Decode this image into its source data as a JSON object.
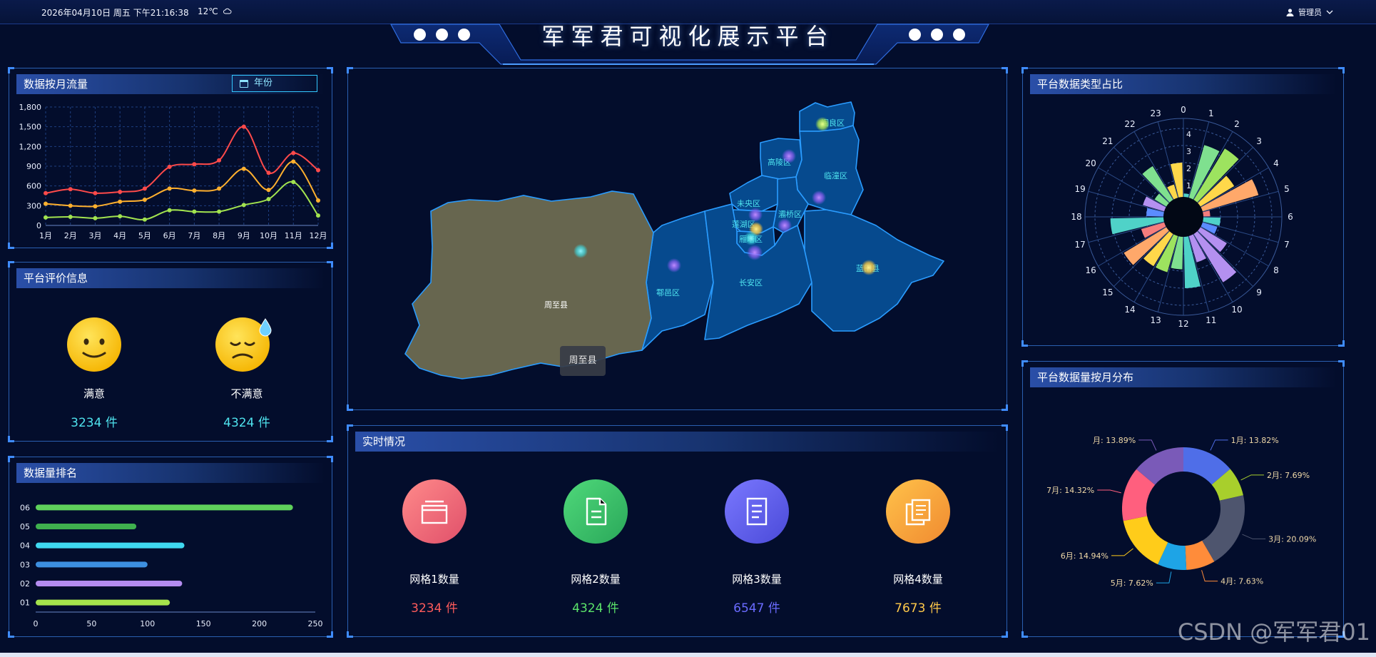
{
  "header": {
    "datetime": "2026年04月10日 周五 下午21:16:38",
    "weather": "12℃",
    "title": "军军君可视化展示平台",
    "user": "管理员"
  },
  "colors": {
    "bg": "#030d2c",
    "panel_border": "#2a5fb0",
    "accent_cyan": "#4fe3ee"
  },
  "panels": {
    "monthly_flow": {
      "title": "数据按月流量",
      "year_button": "年份"
    },
    "evaluation": {
      "title": "平台评价信息",
      "satisfied_label": "满意",
      "satisfied_value": "3234 件",
      "unsatisfied_label": "不满意",
      "unsatisfied_value": "4324 件"
    },
    "ranking": {
      "title": "数据量排名"
    },
    "map": {
      "tooltip": "周至县",
      "regions": [
        "阎良区",
        "高陵区",
        "临潼区",
        "未央区",
        "灞桥区",
        "莲湖区",
        "雁塔区",
        "鄠邑区",
        "长安区",
        "蓝田县",
        "周至县"
      ]
    },
    "realtime": {
      "title": "实时情况",
      "items": [
        {
          "label": "网格1数量",
          "value": "3234 件",
          "color": "#ff5b5b",
          "icon": "box-icon"
        },
        {
          "label": "网格2数量",
          "value": "4324 件",
          "color": "#5be36a",
          "icon": "document-icon"
        },
        {
          "label": "网格3数量",
          "value": "6547 件",
          "color": "#6a6bff",
          "icon": "list-document-icon"
        },
        {
          "label": "网格4数量",
          "value": "7673 件",
          "color": "#ffc94a",
          "icon": "copy-icon"
        }
      ]
    },
    "type_ratio": {
      "title": "平台数据类型占比"
    },
    "monthly_dist": {
      "title": "平台数据量按月分布"
    }
  },
  "watermark": "CSDN @军军君01",
  "chart_data": [
    {
      "id": "monthly-flow",
      "type": "line",
      "categories": [
        "1月",
        "2月",
        "3月",
        "4月",
        "5月",
        "6月",
        "7月",
        "8月",
        "9月",
        "10月",
        "11月",
        "12月"
      ],
      "ylim": [
        0,
        1800
      ],
      "yticks": [
        "0",
        "300",
        "600",
        "900",
        "1,200",
        "1,500",
        "1,800"
      ],
      "grid": true,
      "series": [
        {
          "color": "#ff4a4a",
          "values": [
            490,
            550,
            490,
            510,
            560,
            890,
            930,
            990,
            1500,
            800,
            1100,
            840
          ]
        },
        {
          "color": "#ffb02e",
          "values": [
            330,
            300,
            290,
            360,
            390,
            560,
            530,
            560,
            860,
            540,
            970,
            380
          ]
        },
        {
          "color": "#a2e34f",
          "values": [
            120,
            130,
            110,
            140,
            90,
            230,
            210,
            210,
            310,
            400,
            660,
            150
          ]
        }
      ]
    },
    {
      "id": "ranking",
      "type": "bar",
      "orientation": "horizontal",
      "categories": [
        "06",
        "05",
        "04",
        "03",
        "02",
        "01"
      ],
      "xlim": [
        0,
        250
      ],
      "xticks": [
        "0",
        "50",
        "100",
        "150",
        "200",
        "250"
      ],
      "values": [
        230,
        90,
        133,
        100,
        131,
        120
      ],
      "colors": [
        "#5fd05b",
        "#3fb04e",
        "#3fd8f0",
        "#3d8fe0",
        "#b48cf0",
        "#a5e34c"
      ]
    },
    {
      "id": "type-ratio",
      "type": "bar",
      "polar": true,
      "categories": [
        "0",
        "1",
        "2",
        "3",
        "4",
        "5",
        "6",
        "7",
        "8",
        "9",
        "10",
        "11",
        "12",
        "13",
        "14",
        "15",
        "16",
        "17",
        "18",
        "19",
        "20",
        "21",
        "22",
        "23"
      ],
      "rticks": [
        "1",
        "2",
        "3",
        "4"
      ],
      "rlim": [
        0,
        4
      ],
      "values": [
        0.2,
        3.2,
        3.5,
        2.3,
        3.4,
        0.4,
        1.0,
        0.9,
        1.8,
        3.3,
        1.6,
        3.0,
        1.9,
        2.2,
        2.2,
        2.9,
        1.4,
        3.1,
        1.0,
        1.3,
        0.8,
        2.3,
        0.8,
        2.0
      ],
      "colors": [
        "#4fd2c8",
        "#7fe08f",
        "#9de35f",
        "#ffd84a",
        "#ffa86a",
        "#f57d7d",
        "#4fd2c8",
        "#5b8cff",
        "#b490f0",
        "#b490f0",
        "#b490f0",
        "#4fd2c8",
        "#7fe08f",
        "#9de35f",
        "#ffd84a",
        "#ffa86a",
        "#f57d7d",
        "#4fd2c8",
        "#5b8cff",
        "#b490f0",
        "#7fe08f",
        "#7fe08f",
        "#ffd84a",
        "#ffd84a"
      ]
    },
    {
      "id": "monthly-dist",
      "type": "pie",
      "donut": true,
      "slices": [
        {
          "label": "1月: 13.82%",
          "value": 13.82,
          "color": "#4f6ee8"
        },
        {
          "label": "2月: 7.69%",
          "value": 7.69,
          "color": "#a8cf2c"
        },
        {
          "label": "3月: 20.09%",
          "value": 20.09,
          "color": "#4e556e"
        },
        {
          "label": "4月: 7.63%",
          "value": 7.63,
          "color": "#ff8c3a"
        },
        {
          "label": "5月: 7.62%",
          "value": 7.62,
          "color": "#1ea4e6"
        },
        {
          "label": "6月: 14.94%",
          "value": 14.94,
          "color": "#ffcc1a"
        },
        {
          "label": "7月: 14.32%",
          "value": 14.32,
          "color": "#ff5f7e"
        },
        {
          "label": "月: 13.89%",
          "value": 13.89,
          "color": "#7a5ab8"
        }
      ]
    }
  ]
}
